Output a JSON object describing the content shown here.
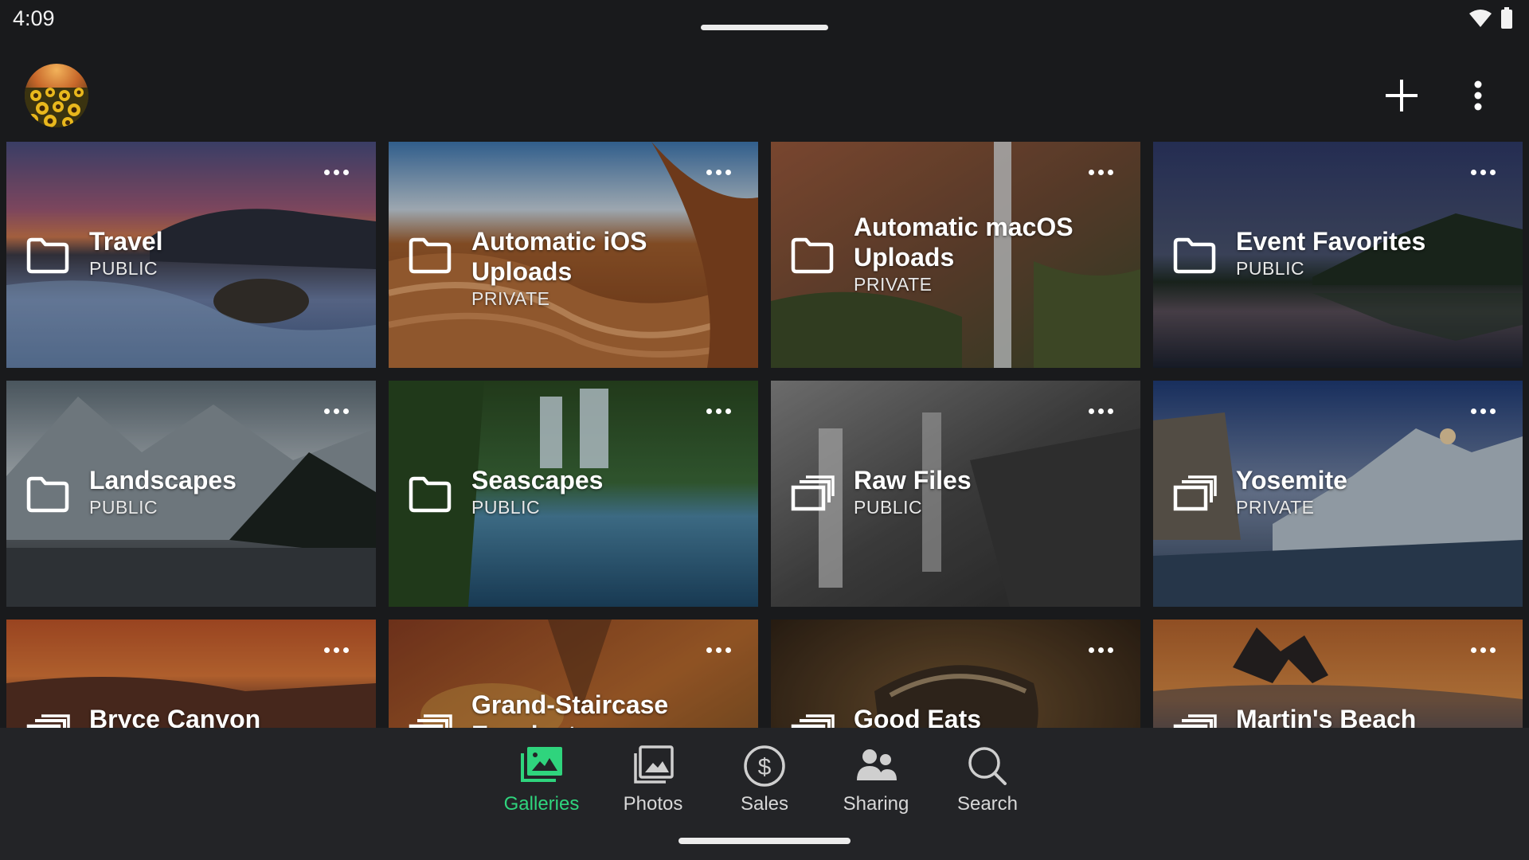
{
  "status": {
    "time": "4:09"
  },
  "app_bar": {
    "avatar": "sunflower-avatar",
    "add_icon": "plus-icon",
    "more_icon": "vertical-dots-icon"
  },
  "galleries": [
    {
      "title": "Travel",
      "privacy": "PUBLIC",
      "icon": "folder-icon",
      "image": "beach-sunset"
    },
    {
      "title": "Automatic iOS Uploads",
      "privacy": "PRIVATE",
      "icon": "folder-icon",
      "image": "sandstone-wave"
    },
    {
      "title": "Automatic macOS Uploads",
      "privacy": "PRIVATE",
      "icon": "folder-icon",
      "image": "canyon-waterfall"
    },
    {
      "title": "Event Favorites",
      "privacy": "PUBLIC",
      "icon": "folder-icon",
      "image": "lake-reflection"
    },
    {
      "title": "Landscapes",
      "privacy": "PUBLIC",
      "icon": "folder-icon",
      "image": "snowy-mountain-lake"
    },
    {
      "title": "Seascapes",
      "privacy": "PUBLIC",
      "icon": "folder-icon",
      "image": "forest-waterfall"
    },
    {
      "title": "Raw Files",
      "privacy": "PUBLIC",
      "icon": "gallery-stack-icon",
      "image": "monochrome-falls"
    },
    {
      "title": "Yosemite",
      "privacy": "PRIVATE",
      "icon": "gallery-stack-icon",
      "image": "winter-valley"
    },
    {
      "title": "Bryce Canyon",
      "privacy": "",
      "icon": "gallery-stack-icon",
      "image": "canyon-sunset"
    },
    {
      "title": "Grand-Staircase Escalante",
      "privacy": "",
      "icon": "gallery-stack-icon",
      "image": "autumn-canyon"
    },
    {
      "title": "Good Eats",
      "privacy": "",
      "icon": "gallery-stack-icon",
      "image": "bread-loaf"
    },
    {
      "title": "Martin's Beach",
      "privacy": "",
      "icon": "gallery-stack-icon",
      "image": "arch-rock-beach"
    }
  ],
  "nav": {
    "items": [
      {
        "label": "Galleries",
        "icon": "galleries-icon",
        "active": true
      },
      {
        "label": "Photos",
        "icon": "photos-icon",
        "active": false
      },
      {
        "label": "Sales",
        "icon": "sales-icon",
        "active": false
      },
      {
        "label": "Sharing",
        "icon": "sharing-icon",
        "active": false
      },
      {
        "label": "Search",
        "icon": "search-icon",
        "active": false
      }
    ]
  },
  "colors": {
    "background": "#191a1c",
    "nav_background": "#232427",
    "accent": "#2fd47d"
  }
}
